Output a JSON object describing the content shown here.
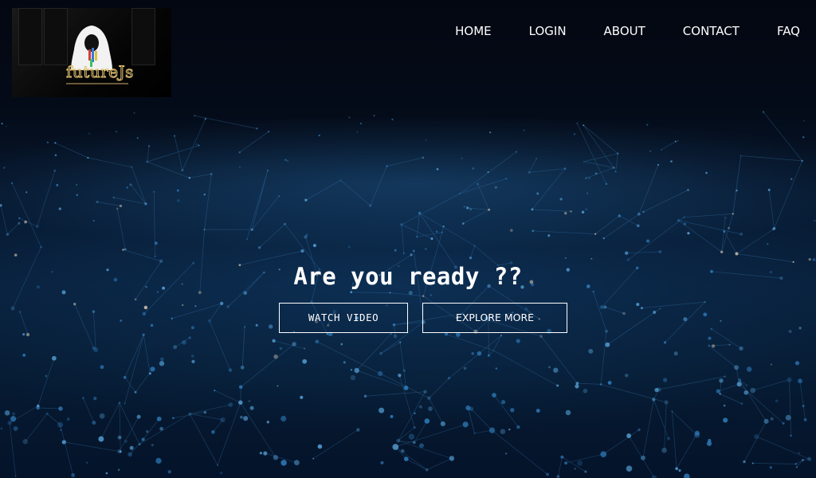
{
  "nav": {
    "items": [
      {
        "label": "HOME"
      },
      {
        "label": "LOGIN"
      },
      {
        "label": "ABOUT"
      },
      {
        "label": "CONTACT"
      },
      {
        "label": "FAQ"
      }
    ]
  },
  "logo": {
    "text": "futureJs",
    "icon": "hooded-figure-icon"
  },
  "hero": {
    "headline": "Are you ready ??",
    "watch_label": "WATCH VIDEO",
    "explore_label": "EXPLORE MORE",
    "background": "network-particles-image"
  },
  "colors": {
    "background": "#02060f",
    "accent": "#2f7fbf",
    "text": "#ffffff"
  }
}
